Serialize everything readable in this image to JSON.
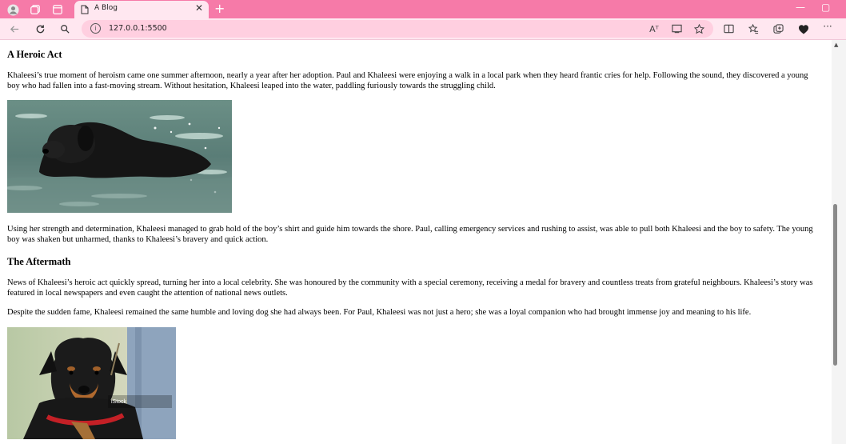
{
  "browser": {
    "tab_title": "A Blog",
    "tab_close": "✕",
    "new_tab": "+",
    "url": "127.0.0.1:5500",
    "win_minimize": "—",
    "win_maximize": "▢",
    "info_glyph": "i",
    "more_glyph": "···",
    "read_aloud_glyph": "Aᵀ",
    "accent_color": "#f67aa8",
    "icons": [
      "profile-icon",
      "workspaces-icon",
      "tab-actions-icon",
      "page-icon",
      "back-icon",
      "refresh-icon",
      "search-icon",
      "info-icon",
      "read-aloud-icon",
      "immersive-reader-icon",
      "favorite-icon",
      "split-screen-icon",
      "favorites-icon",
      "collections-icon",
      "extensions-icon",
      "more-icon"
    ]
  },
  "article": {
    "heading1": "A Heroic Act",
    "para1": "Khaleesi’s true moment of heroism came one summer afternoon, nearly a year after her adoption. Paul and Khaleesi were enjoying a walk in a local park when they heard frantic cries for help. Following the sound, they discovered a young boy who had fallen into a fast-moving stream. Without hesitation, Khaleesi leaped into the water, paddling furiously towards the struggling child.",
    "para2": "Using her strength and determination, Khaleesi managed to grab hold of the boy’s shirt and guide him towards the shore. Paul, calling emergency services and rushing to assist, was able to pull both Khaleesi and the boy to safety. The young boy was shaken but unharmed, thanks to Khaleesi’s bravery and quick action.",
    "heading2": "The Aftermath",
    "para3": "News of Khaleesi’s heroic act quickly spread, turning her into a local celebrity. She was honoured by the community with a special ceremony, receiving a medal for bravery and countless treats from grateful neighbours. Khaleesi’s story was featured in local newspapers and even caught the attention of national news outlets.",
    "para4": "Despite the sudden fame, Khaleesi remained the same humble and loving dog she had always been. For Paul, Khaleesi was not just a hero; she was a loyal companion who had brought immense joy and meaning to his life.",
    "image2_watermark": "iStock"
  }
}
